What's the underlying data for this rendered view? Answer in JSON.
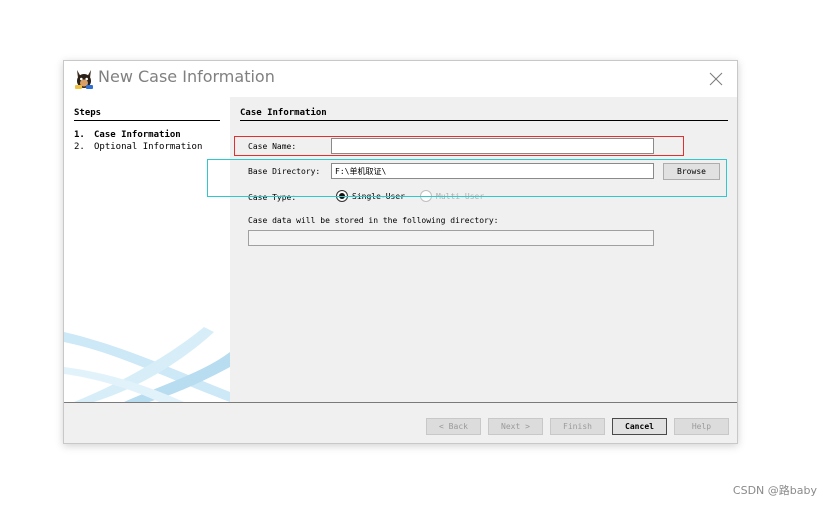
{
  "window": {
    "title": "New Case Information",
    "icon": "autopsy-dog-icon",
    "close_icon": "close-icon"
  },
  "steps": {
    "heading": "Steps",
    "items": [
      {
        "number": "1.",
        "label": "Case Information",
        "active": true
      },
      {
        "number": "2.",
        "label": "Optional Information",
        "active": false
      }
    ]
  },
  "form": {
    "section_title": "Case Information",
    "case_name_label": "Case Name:",
    "case_name_value": "",
    "base_directory_label": "Base Directory:",
    "base_directory_value": "F:\\单机取证\\",
    "browse_label": "Browse",
    "case_type_label": "Case Type:",
    "case_type_options": [
      {
        "label": "Single-User",
        "selected": true,
        "enabled": true
      },
      {
        "label": "Multi-User",
        "selected": false,
        "enabled": false
      }
    ],
    "storage_note": "Case data will be stored in the following directory:",
    "storage_path_value": ""
  },
  "footer": {
    "back_label": "< Back",
    "next_label": "Next >",
    "finish_label": "Finish",
    "cancel_label": "Cancel",
    "help_label": "Help"
  },
  "annotations": {
    "red_box_color": "#e03030",
    "cyan_box_color": "#30c8d0"
  },
  "watermark": "CSDN @路baby"
}
